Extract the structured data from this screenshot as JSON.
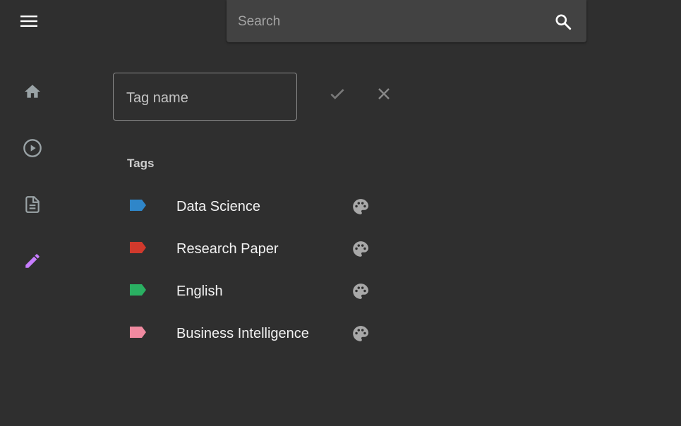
{
  "header": {
    "menu_icon": "hamburger-menu-icon",
    "search": {
      "placeholder": "Search",
      "value": "",
      "icon": "search-icon"
    }
  },
  "sidebar": {
    "items": [
      {
        "id": "home",
        "icon": "home-icon",
        "active": false
      },
      {
        "id": "videos",
        "icon": "play-circle-icon",
        "active": false
      },
      {
        "id": "documents",
        "icon": "document-icon",
        "active": false
      },
      {
        "id": "tags",
        "icon": "pencil-icon",
        "active": true
      }
    ],
    "active_color": "#c77dff",
    "inactive_color": "#9aa3a6"
  },
  "tag_editor": {
    "input_placeholder": "Tag name",
    "input_value": "",
    "confirm_icon": "check-icon",
    "cancel_icon": "close-icon"
  },
  "tags": {
    "section_title": "Tags",
    "items": [
      {
        "label": "Data Science",
        "color": "#2f86c9",
        "palette_icon": "palette-icon"
      },
      {
        "label": "Research Paper",
        "color": "#d0392c",
        "palette_icon": "palette-icon"
      },
      {
        "label": "English",
        "color": "#2ab062",
        "palette_icon": "palette-icon"
      },
      {
        "label": "Business Intelligence",
        "color": "#f08aa0",
        "palette_icon": "palette-icon"
      }
    ]
  }
}
